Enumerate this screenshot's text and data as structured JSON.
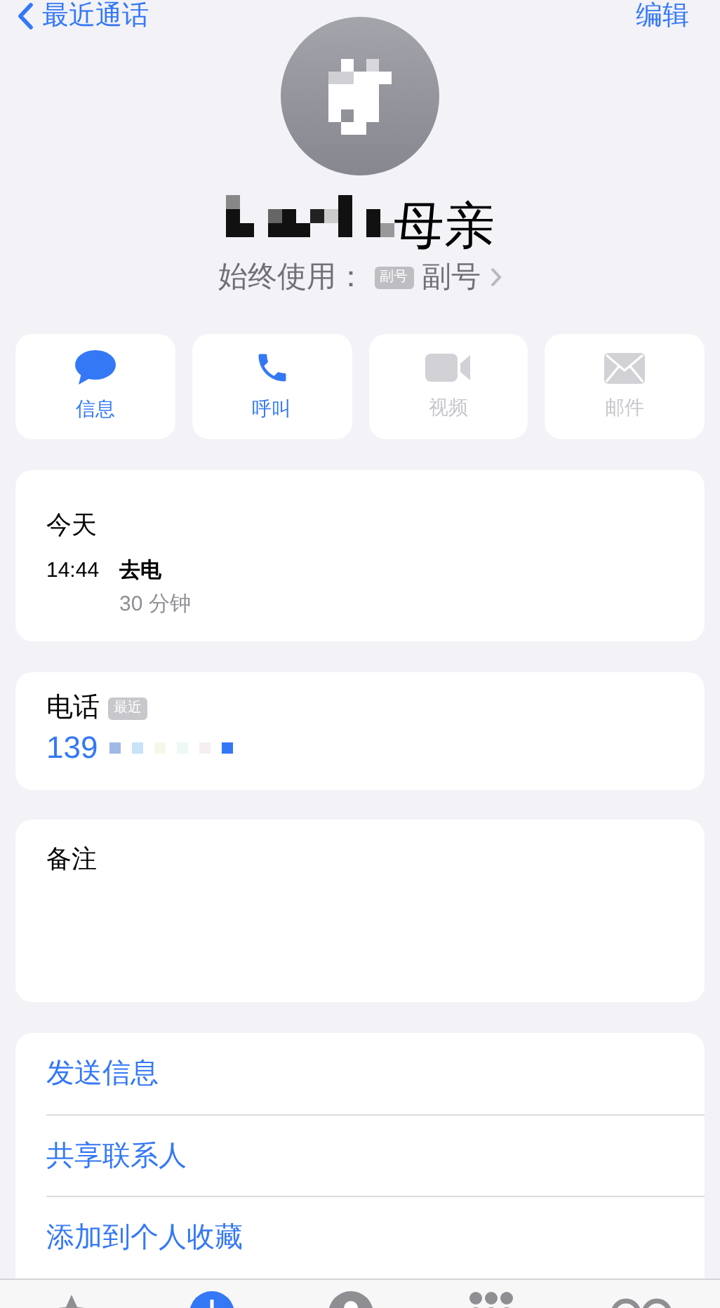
{
  "nav": {
    "back": "最近通话",
    "edit": "编辑"
  },
  "contact": {
    "name": "母亲",
    "default_label": "始终使用：",
    "line_badge": "副号",
    "line_name": "副号"
  },
  "actions": [
    {
      "kind": "message",
      "label": "信息",
      "disabled": false
    },
    {
      "kind": "call",
      "label": "呼叫",
      "disabled": false
    },
    {
      "kind": "video",
      "label": "视频",
      "disabled": true
    },
    {
      "kind": "mail",
      "label": "邮件",
      "disabled": true
    }
  ],
  "recent": {
    "heading": "今天",
    "calls": [
      {
        "time": "14:44",
        "type": "去电",
        "duration": "30 分钟"
      }
    ]
  },
  "phone": {
    "label": "电话",
    "badge": "最近",
    "number": "139"
  },
  "notes": {
    "label": "备注"
  },
  "links": [
    "发送信息",
    "共享联系人",
    "添加到个人收藏"
  ],
  "tab_bar": [
    {
      "kind": "favorites",
      "selected": false
    },
    {
      "kind": "recents",
      "selected": true
    },
    {
      "kind": "contacts",
      "selected": false
    },
    {
      "kind": "keypad",
      "selected": false
    },
    {
      "kind": "voicemail",
      "selected": false
    }
  ]
}
